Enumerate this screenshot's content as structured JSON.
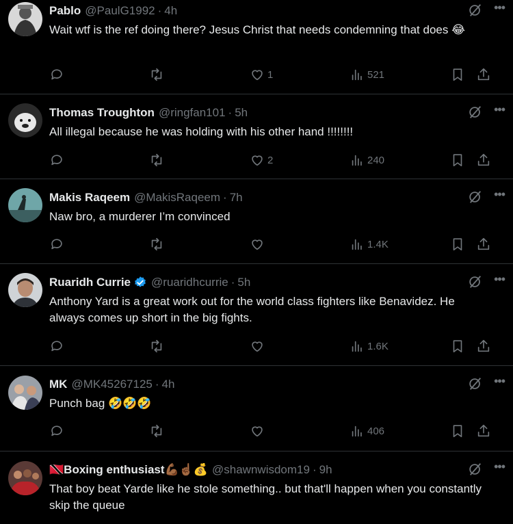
{
  "colors": {
    "background": "#000000",
    "text": "#e7e9ea",
    "muted": "#71767b",
    "divider": "#2f3336",
    "verified": "#1d9bf0"
  },
  "posts": [
    {
      "name": "Pablo",
      "handle": "@PaulG1992",
      "sep": "·",
      "time": "4h",
      "text": "Wait wtf is the ref doing there? Jesus Christ that needs condemning that does 😂",
      "replies": "",
      "retweets": "",
      "likes": "1",
      "views": "521",
      "avatar_icon": "avatar-bw-photo"
    },
    {
      "name": "Thomas Troughton",
      "handle": "@ringfan101",
      "sep": "·",
      "time": "5h",
      "text": "All illegal because he was holding with his other hand !!!!!!!!",
      "replies": "",
      "retweets": "",
      "likes": "2",
      "views": "240",
      "avatar_icon": "avatar-bulldog"
    },
    {
      "name": "Makis Raqeem",
      "handle": "@MakisRaqeem",
      "sep": "·",
      "time": "7h",
      "text": "Naw bro, a murderer I’m convinced",
      "replies": "",
      "retweets": "",
      "likes": "",
      "views": "1.4K",
      "avatar_icon": "avatar-teal-scene"
    },
    {
      "name": "Ruaridh Currie",
      "handle": "@ruaridhcurrie",
      "sep": "·",
      "time": "5h",
      "text": "Anthony Yard is a great work out for the world class fighters like Benavidez. He always comes up short in the big fights.",
      "replies": "",
      "retweets": "",
      "likes": "",
      "views": "1.6K",
      "avatar_icon": "avatar-man-portrait",
      "verified": true
    },
    {
      "name": "MK",
      "handle": "@MK45267125",
      "sep": "·",
      "time": "4h",
      "text": "Punch bag 🤣🤣🤣",
      "replies": "",
      "retweets": "",
      "likes": "",
      "views": "406",
      "avatar_icon": "avatar-crowd"
    },
    {
      "name": "🇹🇹Boxing enthusiast💪🏾☝🏾💰",
      "handle": "@shawnwisdom19",
      "sep": "·",
      "time": "9h",
      "text": "That boy beat Yarde like he stole something.. but that'll happen when you constantly skip the queue",
      "replies": "",
      "retweets": "",
      "likes": "",
      "views": "",
      "avatar_icon": "avatar-red-group"
    }
  ]
}
